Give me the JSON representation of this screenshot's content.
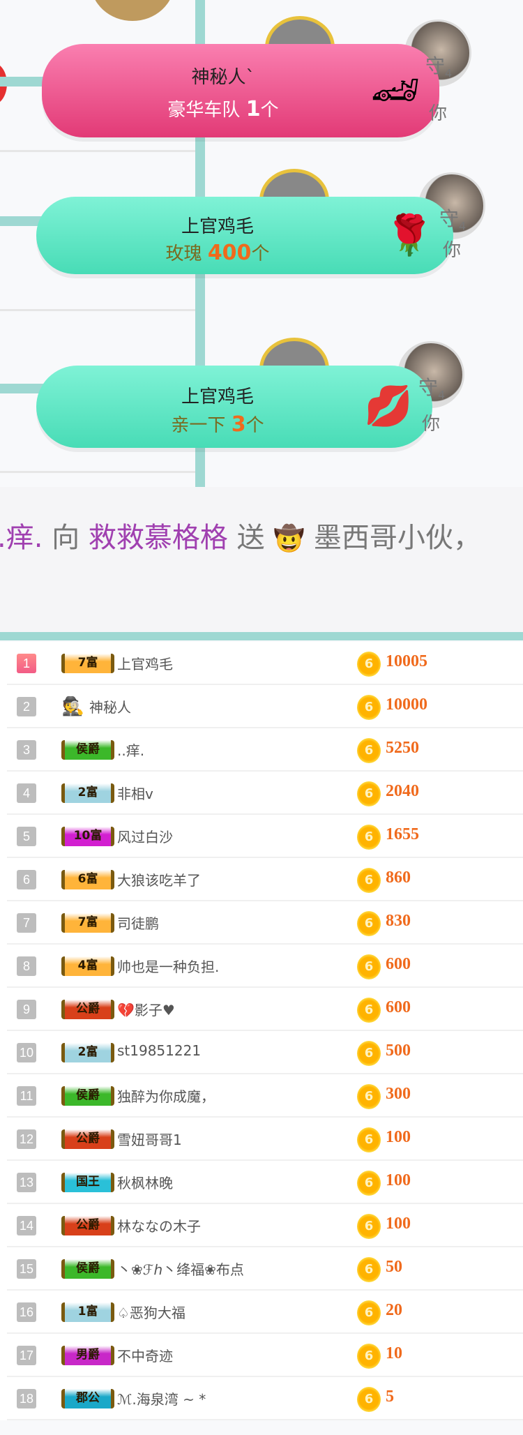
{
  "colors": {
    "accent_teal": "#9ed8d2",
    "banner_pink": "#e23a76",
    "banner_teal": "#48dcb6",
    "amount_orange": "#f06a1c",
    "sender_purple": "#a040b0"
  },
  "gift_feed": [
    {
      "sender": "神秘人`",
      "gift": "豪华车队",
      "count": "1",
      "unit": "个",
      "icon": "car-icon",
      "theme": "pink",
      "guard": "守",
      "guard_level": "4",
      "guard_sub": "你"
    },
    {
      "sender": "上官鸡毛",
      "gift": "玫瑰",
      "count": "400",
      "unit": "个",
      "icon": "rose-icon",
      "theme": "teal",
      "guard": "守",
      "guard_level": "4",
      "guard_sub": "你"
    },
    {
      "sender": "上官鸡毛",
      "gift": "亲一下",
      "count": "3",
      "unit": "个",
      "icon": "lips-icon",
      "theme": "teal",
      "guard": "守",
      "guard_level": "4",
      "guard_sub": "你"
    }
  ],
  "ticker": {
    "sender": ".痒.",
    "to": "向",
    "receiver": "救救慕格格",
    "verb": "送",
    "gift_icon": "mexican-guy-icon",
    "gift": "墨西哥小伙，"
  },
  "ranking": [
    {
      "rank": "1",
      "badge": "7富",
      "badge_color": "#ffb43a",
      "name": "上官鸡毛",
      "coin": "6",
      "amount": "10005"
    },
    {
      "rank": "2",
      "badge": "",
      "badge_icon": "mystery-person-icon",
      "name": "神秘人",
      "coin": "6",
      "amount": "10000"
    },
    {
      "rank": "3",
      "badge": "侯爵",
      "badge_color": "#3cb82a",
      "name": "..痒.",
      "coin": "6",
      "amount": "5250"
    },
    {
      "rank": "4",
      "badge": "2富",
      "badge_color": "#9fd3e0",
      "name": "非相v",
      "coin": "6",
      "amount": "2040"
    },
    {
      "rank": "5",
      "badge": "10富",
      "badge_color": "#d21fd0",
      "name": "风过白沙",
      "coin": "6",
      "amount": "1655"
    },
    {
      "rank": "6",
      "badge": "6富",
      "badge_color": "#ffb43a",
      "name": "大狼该吃羊了",
      "coin": "6",
      "amount": "860"
    },
    {
      "rank": "7",
      "badge": "7富",
      "badge_color": "#ffb43a",
      "name": "司徒鹏",
      "coin": "6",
      "amount": "830"
    },
    {
      "rank": "8",
      "badge": "4富",
      "badge_color": "#ffb43a",
      "name": "帅也是一种负担.",
      "coin": "6",
      "amount": "600"
    },
    {
      "rank": "9",
      "badge": "公爵",
      "badge_color": "#d8401a",
      "name": "💔影子♥",
      "coin": "6",
      "amount": "600"
    },
    {
      "rank": "10",
      "badge": "2富",
      "badge_color": "#9fd3e0",
      "name": "st19851221",
      "coin": "6",
      "amount": "500"
    },
    {
      "rank": "11",
      "badge": "侯爵",
      "badge_color": "#3cb82a",
      "name": "独醉为你成魔，",
      "coin": "6",
      "amount": "300"
    },
    {
      "rank": "12",
      "badge": "公爵",
      "badge_color": "#d8401a",
      "name": "雪妞哥哥1",
      "coin": "6",
      "amount": "100"
    },
    {
      "rank": "13",
      "badge": "国王",
      "badge_color": "#2ac0d8",
      "name": "秋枫林晚",
      "coin": "6",
      "amount": "100"
    },
    {
      "rank": "14",
      "badge": "公爵",
      "badge_color": "#d8401a",
      "name": "林ななの木子",
      "coin": "6",
      "amount": "100"
    },
    {
      "rank": "15",
      "badge": "侯爵",
      "badge_color": "#3cb82a",
      "name": "丶❀ℱℎ丶绛福❀布点",
      "coin": "6",
      "amount": "50"
    },
    {
      "rank": "16",
      "badge": "1富",
      "badge_color": "#9fd3e0",
      "name": "♤恶狗大福",
      "coin": "6",
      "amount": "20"
    },
    {
      "rank": "17",
      "badge": "男爵",
      "badge_color": "#c828c8",
      "name": "不中奇迹",
      "coin": "6",
      "amount": "10"
    },
    {
      "rank": "18",
      "badge": "郡公",
      "badge_color": "#1aa8c8",
      "name": "ℳ.海泉湾 ~ *",
      "coin": "6",
      "amount": "5"
    }
  ]
}
